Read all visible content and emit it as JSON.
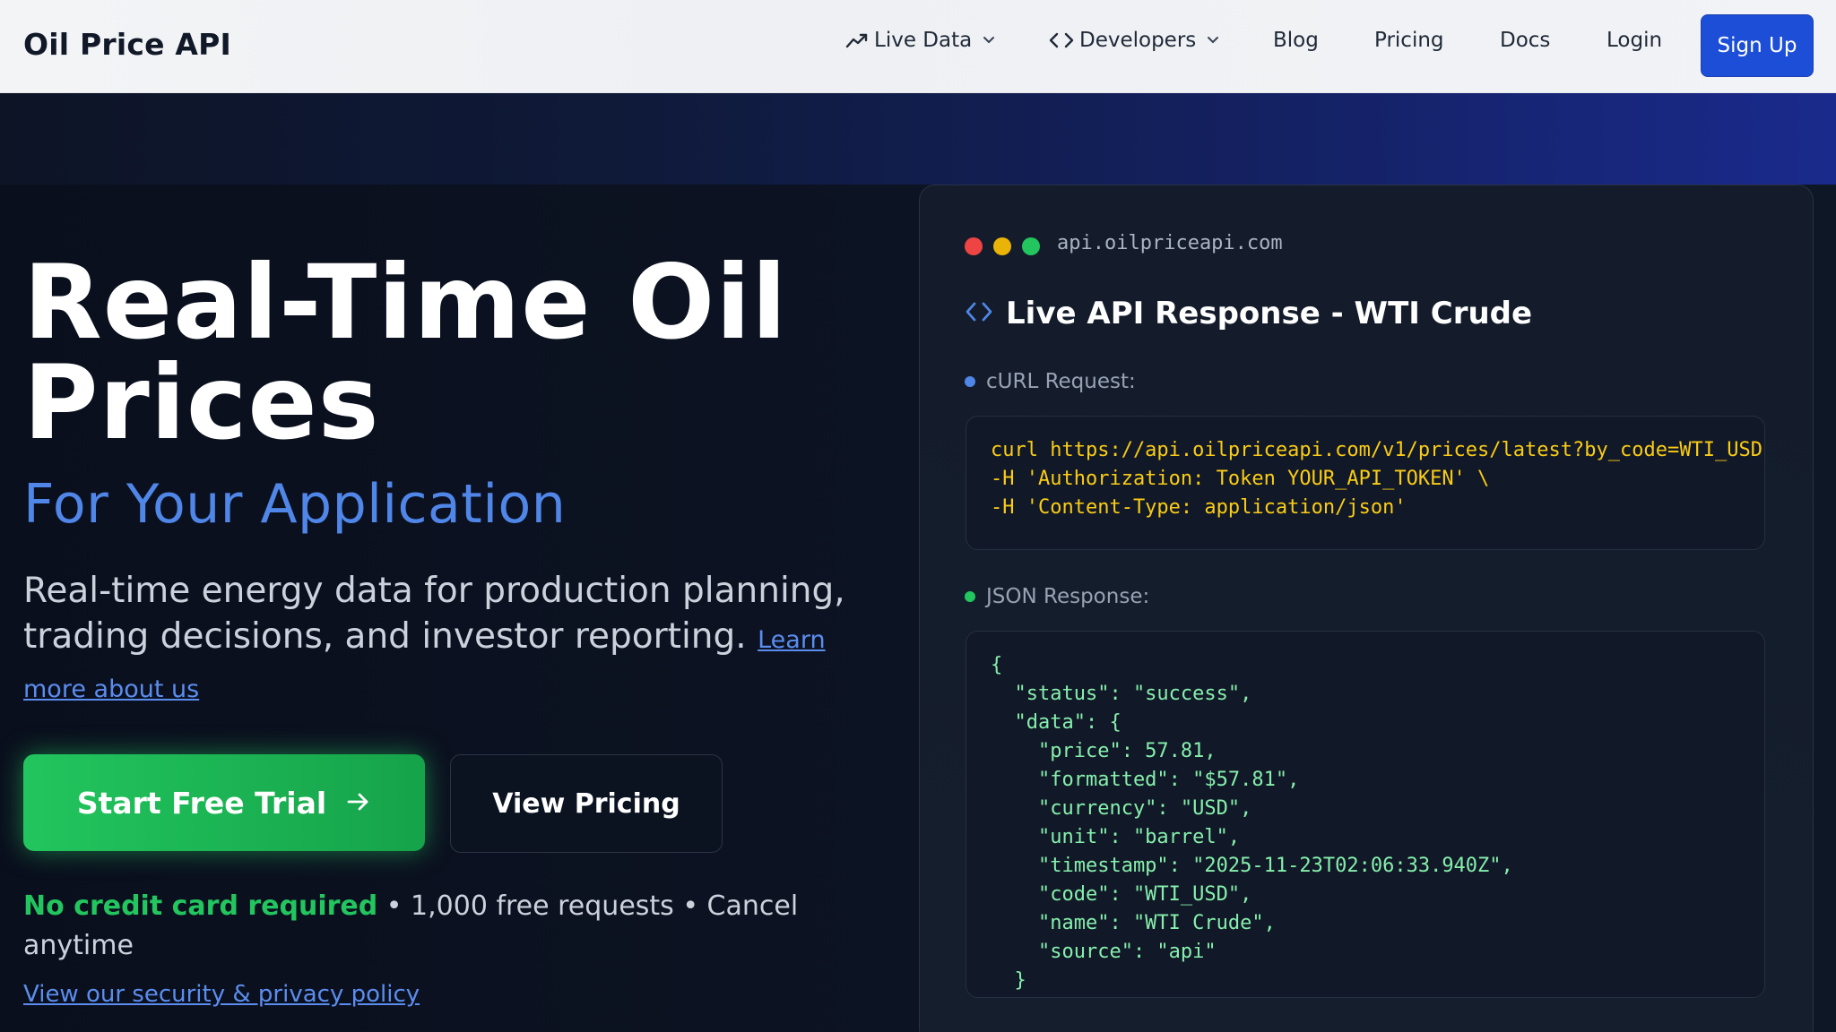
{
  "nav": {
    "logo": "Oil Price API",
    "items": {
      "live_data": "Live Data",
      "developers": "Developers",
      "blog": "Blog",
      "pricing": "Pricing",
      "docs": "Docs",
      "login": "Login"
    },
    "signup": "Sign Up"
  },
  "hero": {
    "headline": "Real-Time Oil Prices",
    "subhead": "For Your Application",
    "description": "Real-time energy data for production planning, trading decisions, and investor reporting.",
    "learn_more": "Learn more about us",
    "cta_primary": "Start Free Trial",
    "cta_secondary": "View Pricing",
    "fine_highlight": "No credit card required",
    "fine_rest": " • 1,000 free requests • Cancel anytime",
    "policy_link": "View our security & privacy policy"
  },
  "panel": {
    "host": "api.oilpriceapi.com",
    "title": "Live API Response - WTI Crude",
    "curl_label": "cURL Request:",
    "curl_code": "curl https://api.oilpriceapi.com/v1/prices/latest?by_code=WTI_USD \\\n-H 'Authorization: Token YOUR_API_TOKEN' \\\n-H 'Content-Type: application/json'",
    "json_label": "JSON Response:",
    "json_code": "{\n  \"status\": \"success\",\n  \"data\": {\n    \"price\": 57.81,\n    \"formatted\": \"$57.81\",\n    \"currency\": \"USD\",\n    \"unit\": \"barrel\",\n    \"timestamp\": \"2025-11-23T02:06:33.940Z\",\n    \"code\": \"WTI_USD\",\n    \"name\": \"WTI Crude\",\n    \"source\": \"api\"\n  }"
  },
  "colors": {
    "accent_blue": "#1d4ed8",
    "subhead_blue": "#4f86e8",
    "cta_green": "#22c55e",
    "curl_yellow": "#facc15",
    "json_green": "#86efac"
  },
  "icons": [
    "trending-up-icon",
    "code-icon",
    "chevron-down-icon",
    "arrow-right-icon"
  ]
}
